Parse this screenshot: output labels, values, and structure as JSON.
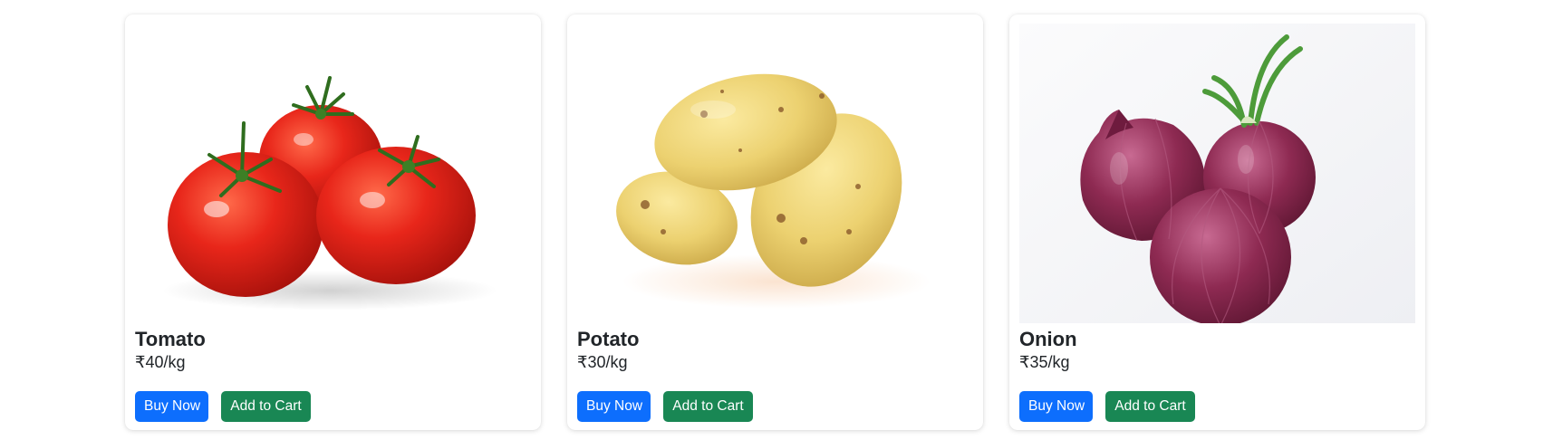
{
  "products": [
    {
      "name": "Tomato",
      "price": "₹40/kg",
      "image": "tomatoes-image",
      "buy_label": "Buy Now",
      "cart_label": "Add to Cart"
    },
    {
      "name": "Potato",
      "price": "₹30/kg",
      "image": "potatoes-image",
      "buy_label": "Buy Now",
      "cart_label": "Add to Cart"
    },
    {
      "name": "Onion",
      "price": "₹35/kg",
      "image": "red-onions-image",
      "buy_label": "Buy Now",
      "cart_label": "Add to Cart"
    }
  ],
  "colors": {
    "buy_button": "#0d6efd",
    "cart_button": "#198754",
    "text": "#212529",
    "card_background": "#ffffff"
  }
}
